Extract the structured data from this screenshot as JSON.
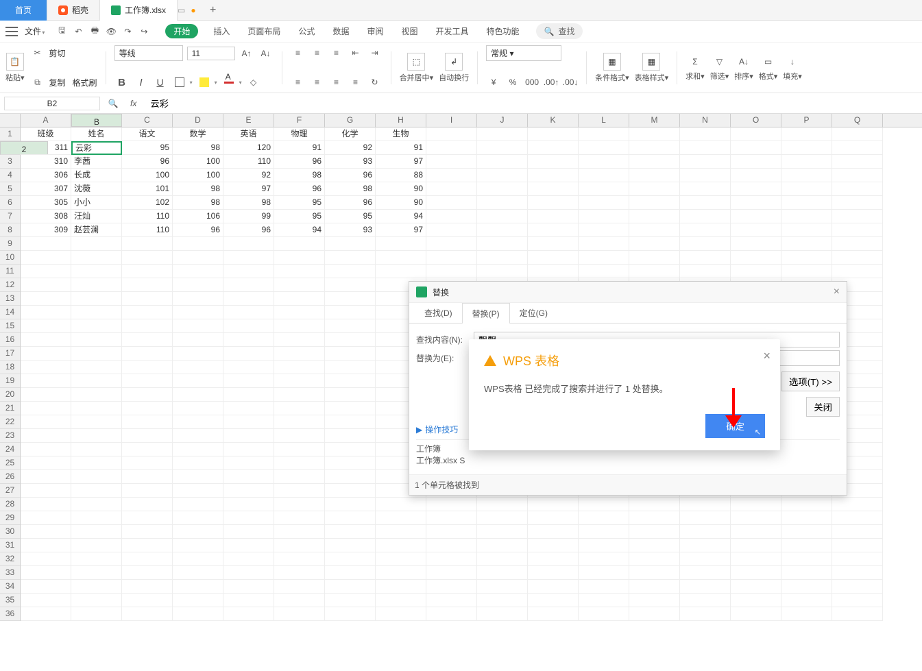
{
  "tabs": {
    "home": "首页",
    "docshell": "稻壳",
    "workbook": "工作簿.xlsx",
    "add": "+"
  },
  "file_btn": "文件",
  "menu": {
    "start": "开始",
    "insert": "插入",
    "pageLayout": "页面布局",
    "formula": "公式",
    "data": "数据",
    "review": "审阅",
    "view": "视图",
    "devtools": "开发工具",
    "features": "特色功能",
    "search": "查找"
  },
  "ribbon": {
    "paste": "粘贴",
    "cut": "剪切",
    "copy": "复制",
    "format_painter": "格式刷",
    "font": "等线",
    "size": "11",
    "merge": "合并居中",
    "wrap": "自动换行",
    "number_format": "常规",
    "cond_fmt": "条件格式",
    "table_style": "表格样式",
    "sum": "求和",
    "filter": "筛选",
    "sort": "排序",
    "format": "格式",
    "fill": "填充"
  },
  "formula_bar": {
    "name_box": "B2",
    "fx": "fx",
    "value": "云彩"
  },
  "columns": [
    "A",
    "B",
    "C",
    "D",
    "E",
    "F",
    "G",
    "H",
    "I",
    "J",
    "K",
    "L",
    "M",
    "N",
    "O",
    "P",
    "Q"
  ],
  "active_col_index": 1,
  "row_count": 36,
  "active_row_index": 2,
  "headers": [
    "班级",
    "姓名",
    "语文",
    "数学",
    "英语",
    "物理",
    "化学",
    "生物"
  ],
  "data_rows": [
    {
      "cls": 311,
      "name": "云彩",
      "yw": 95,
      "sx": 98,
      "yy": 120,
      "wl": 91,
      "hx": 92,
      "sw": 91
    },
    {
      "cls": 310,
      "name": "李茜",
      "yw": 96,
      "sx": 100,
      "yy": 110,
      "wl": 96,
      "hx": 93,
      "sw": 97
    },
    {
      "cls": 306,
      "name": "长成",
      "yw": 100,
      "sx": 100,
      "yy": 92,
      "wl": 98,
      "hx": 96,
      "sw": 88
    },
    {
      "cls": 307,
      "name": "沈薇",
      "yw": 101,
      "sx": 98,
      "yy": 97,
      "wl": 96,
      "hx": 98,
      "sw": 90
    },
    {
      "cls": 305,
      "name": "小小",
      "yw": 102,
      "sx": 98,
      "yy": 98,
      "wl": 95,
      "hx": 96,
      "sw": 90
    },
    {
      "cls": 308,
      "name": "汪灿",
      "yw": 110,
      "sx": 106,
      "yy": 99,
      "wl": 95,
      "hx": 95,
      "sw": 94
    },
    {
      "cls": 309,
      "name": "赵芸澜",
      "yw": 110,
      "sx": 96,
      "yy": 96,
      "wl": 94,
      "hx": 93,
      "sw": 97
    }
  ],
  "dialog": {
    "title": "替换",
    "tabs": {
      "find": "查找(D)",
      "replace": "替换(P)",
      "goto": "定位(G)"
    },
    "find_label": "查找内容(N):",
    "find_value": "飘飘",
    "replace_label": "替换为(E):",
    "replace_value": "",
    "options": "选项(T) >>",
    "close": "关闭",
    "tips": "操作技巧",
    "result1": "工作簿",
    "result2": "工作簿.xlsx  S",
    "status": "1 个单元格被找到"
  },
  "alert": {
    "title": "WPS 表格",
    "message": "WPS表格 已经完成了搜索并进行了 1 处替换。",
    "ok": "确定"
  }
}
